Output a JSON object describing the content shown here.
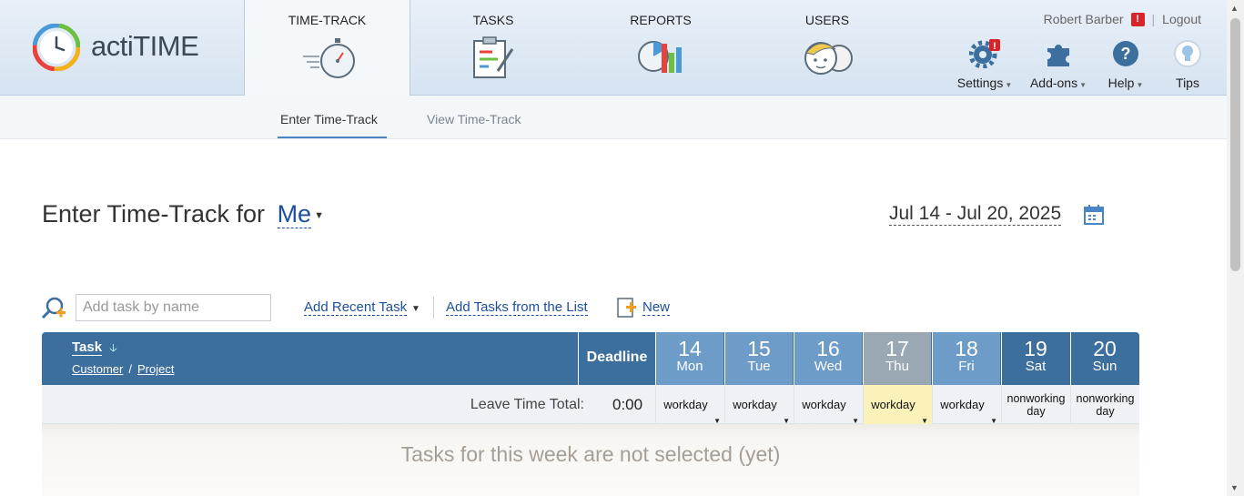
{
  "app": {
    "logo_text": "actiTIME"
  },
  "nav": {
    "tabs": [
      {
        "label": "TIME-TRACK",
        "icon": "stopwatch-icon",
        "active": true
      },
      {
        "label": "TASKS",
        "icon": "clipboard-icon",
        "active": false
      },
      {
        "label": "REPORTS",
        "icon": "reports-chart-icon",
        "active": false
      },
      {
        "label": "USERS",
        "icon": "users-icon",
        "active": false
      }
    ],
    "user_name": "Robert Barber",
    "logout_label": "Logout",
    "tools": [
      {
        "label": "Settings",
        "icon": "gear-icon"
      },
      {
        "label": "Add-ons",
        "icon": "puzzle-icon"
      },
      {
        "label": "Help",
        "icon": "help-icon"
      },
      {
        "label": "Tips",
        "icon": "lightbulb-icon"
      }
    ]
  },
  "subnav": {
    "enter": "Enter Time-Track",
    "view": "View Time-Track"
  },
  "heading": {
    "prefix": "Enter Time-Track for",
    "user": "Me",
    "date_range": "Jul 14 - Jul 20, 2025"
  },
  "taskbar": {
    "search_placeholder": "Add task by name",
    "add_recent": "Add Recent Task",
    "add_from_list": "Add Tasks from the List",
    "new": "New"
  },
  "grid": {
    "task_header": "Task",
    "customer": "Customer",
    "slash": "/",
    "project": "Project",
    "deadline": "Deadline",
    "days": [
      {
        "num": "14",
        "name": "Mon",
        "status": "workday",
        "kind": "work"
      },
      {
        "num": "15",
        "name": "Tue",
        "status": "workday",
        "kind": "work"
      },
      {
        "num": "16",
        "name": "Wed",
        "status": "workday",
        "kind": "work"
      },
      {
        "num": "17",
        "name": "Thu",
        "status": "workday",
        "kind": "today"
      },
      {
        "num": "18",
        "name": "Fri",
        "status": "workday",
        "kind": "work"
      },
      {
        "num": "19",
        "name": "Sat",
        "status": "nonworking day",
        "kind": "weekend"
      },
      {
        "num": "20",
        "name": "Sun",
        "status": "nonworking day",
        "kind": "weekend"
      }
    ],
    "leave_label": "Leave Time Total:",
    "leave_total": "0:00",
    "empty_message": "Tasks for this week are not selected (yet)"
  },
  "colors": {
    "header_blue": "#3c6f9e",
    "workday_blue": "#6d9cc8",
    "today_gray": "#9aa8b3",
    "link_blue": "#1c4f9c",
    "alert_red": "#d8232a"
  }
}
